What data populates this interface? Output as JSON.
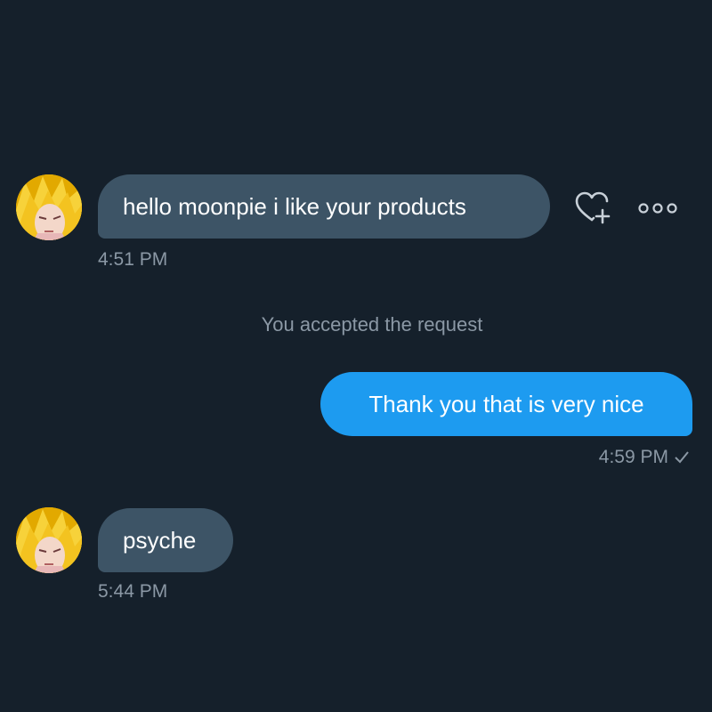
{
  "conversation": {
    "messages": [
      {
        "direction": "incoming",
        "text": "hello moonpie i like your products",
        "time": "4:51 PM"
      },
      {
        "direction": "outgoing",
        "text": "Thank you that is very nice",
        "time": "4:59 PM"
      },
      {
        "direction": "incoming",
        "text": "psyche",
        "time": "5:44 PM"
      }
    ],
    "system_note": "You accepted the request"
  },
  "icons": {
    "react": "heart-plus-icon",
    "more": "more-horizontal-icon",
    "read_receipt": "check-icon"
  },
  "colors": {
    "background": "#15202b",
    "incoming_bubble": "#3d5466",
    "outgoing_bubble": "#1d9bf0",
    "timestamp_text": "#8b98a5"
  }
}
